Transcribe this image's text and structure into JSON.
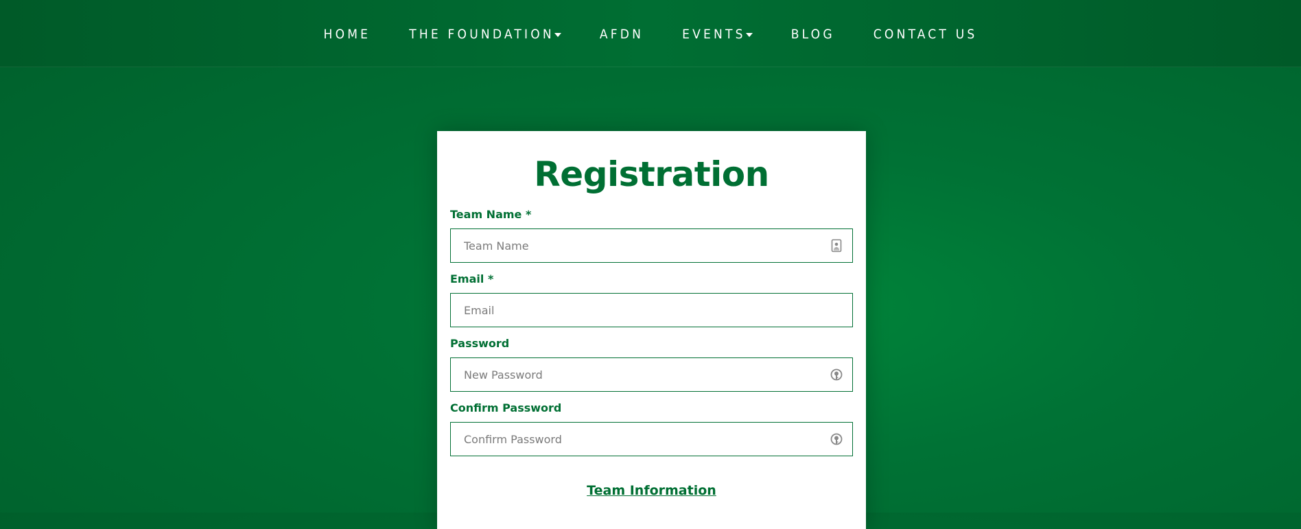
{
  "nav": {
    "items": [
      {
        "label": "HOME",
        "has_dropdown": false
      },
      {
        "label": "THE FOUNDATION",
        "has_dropdown": true
      },
      {
        "label": "AFDN",
        "has_dropdown": false
      },
      {
        "label": "EVENTS",
        "has_dropdown": true
      },
      {
        "label": "BLOG",
        "has_dropdown": false
      },
      {
        "label": "CONTACT US",
        "has_dropdown": false
      }
    ]
  },
  "form": {
    "title": "Registration",
    "fields": {
      "team_name": {
        "label": "Team Name *",
        "placeholder": "Team Name",
        "value": "",
        "icon": "contact-card-icon"
      },
      "email": {
        "label": "Email *",
        "placeholder": "Email",
        "value": ""
      },
      "password": {
        "label": "Password",
        "placeholder": "New Password",
        "value": "",
        "icon": "password-key-icon"
      },
      "confirm_password": {
        "label": "Confirm Password",
        "placeholder": "Confirm Password",
        "value": "",
        "icon": "password-key-icon"
      }
    },
    "section_link": "Team Information"
  },
  "colors": {
    "brand_green": "#006f33",
    "background_green": "#007235",
    "nav_green": "#005a28"
  }
}
